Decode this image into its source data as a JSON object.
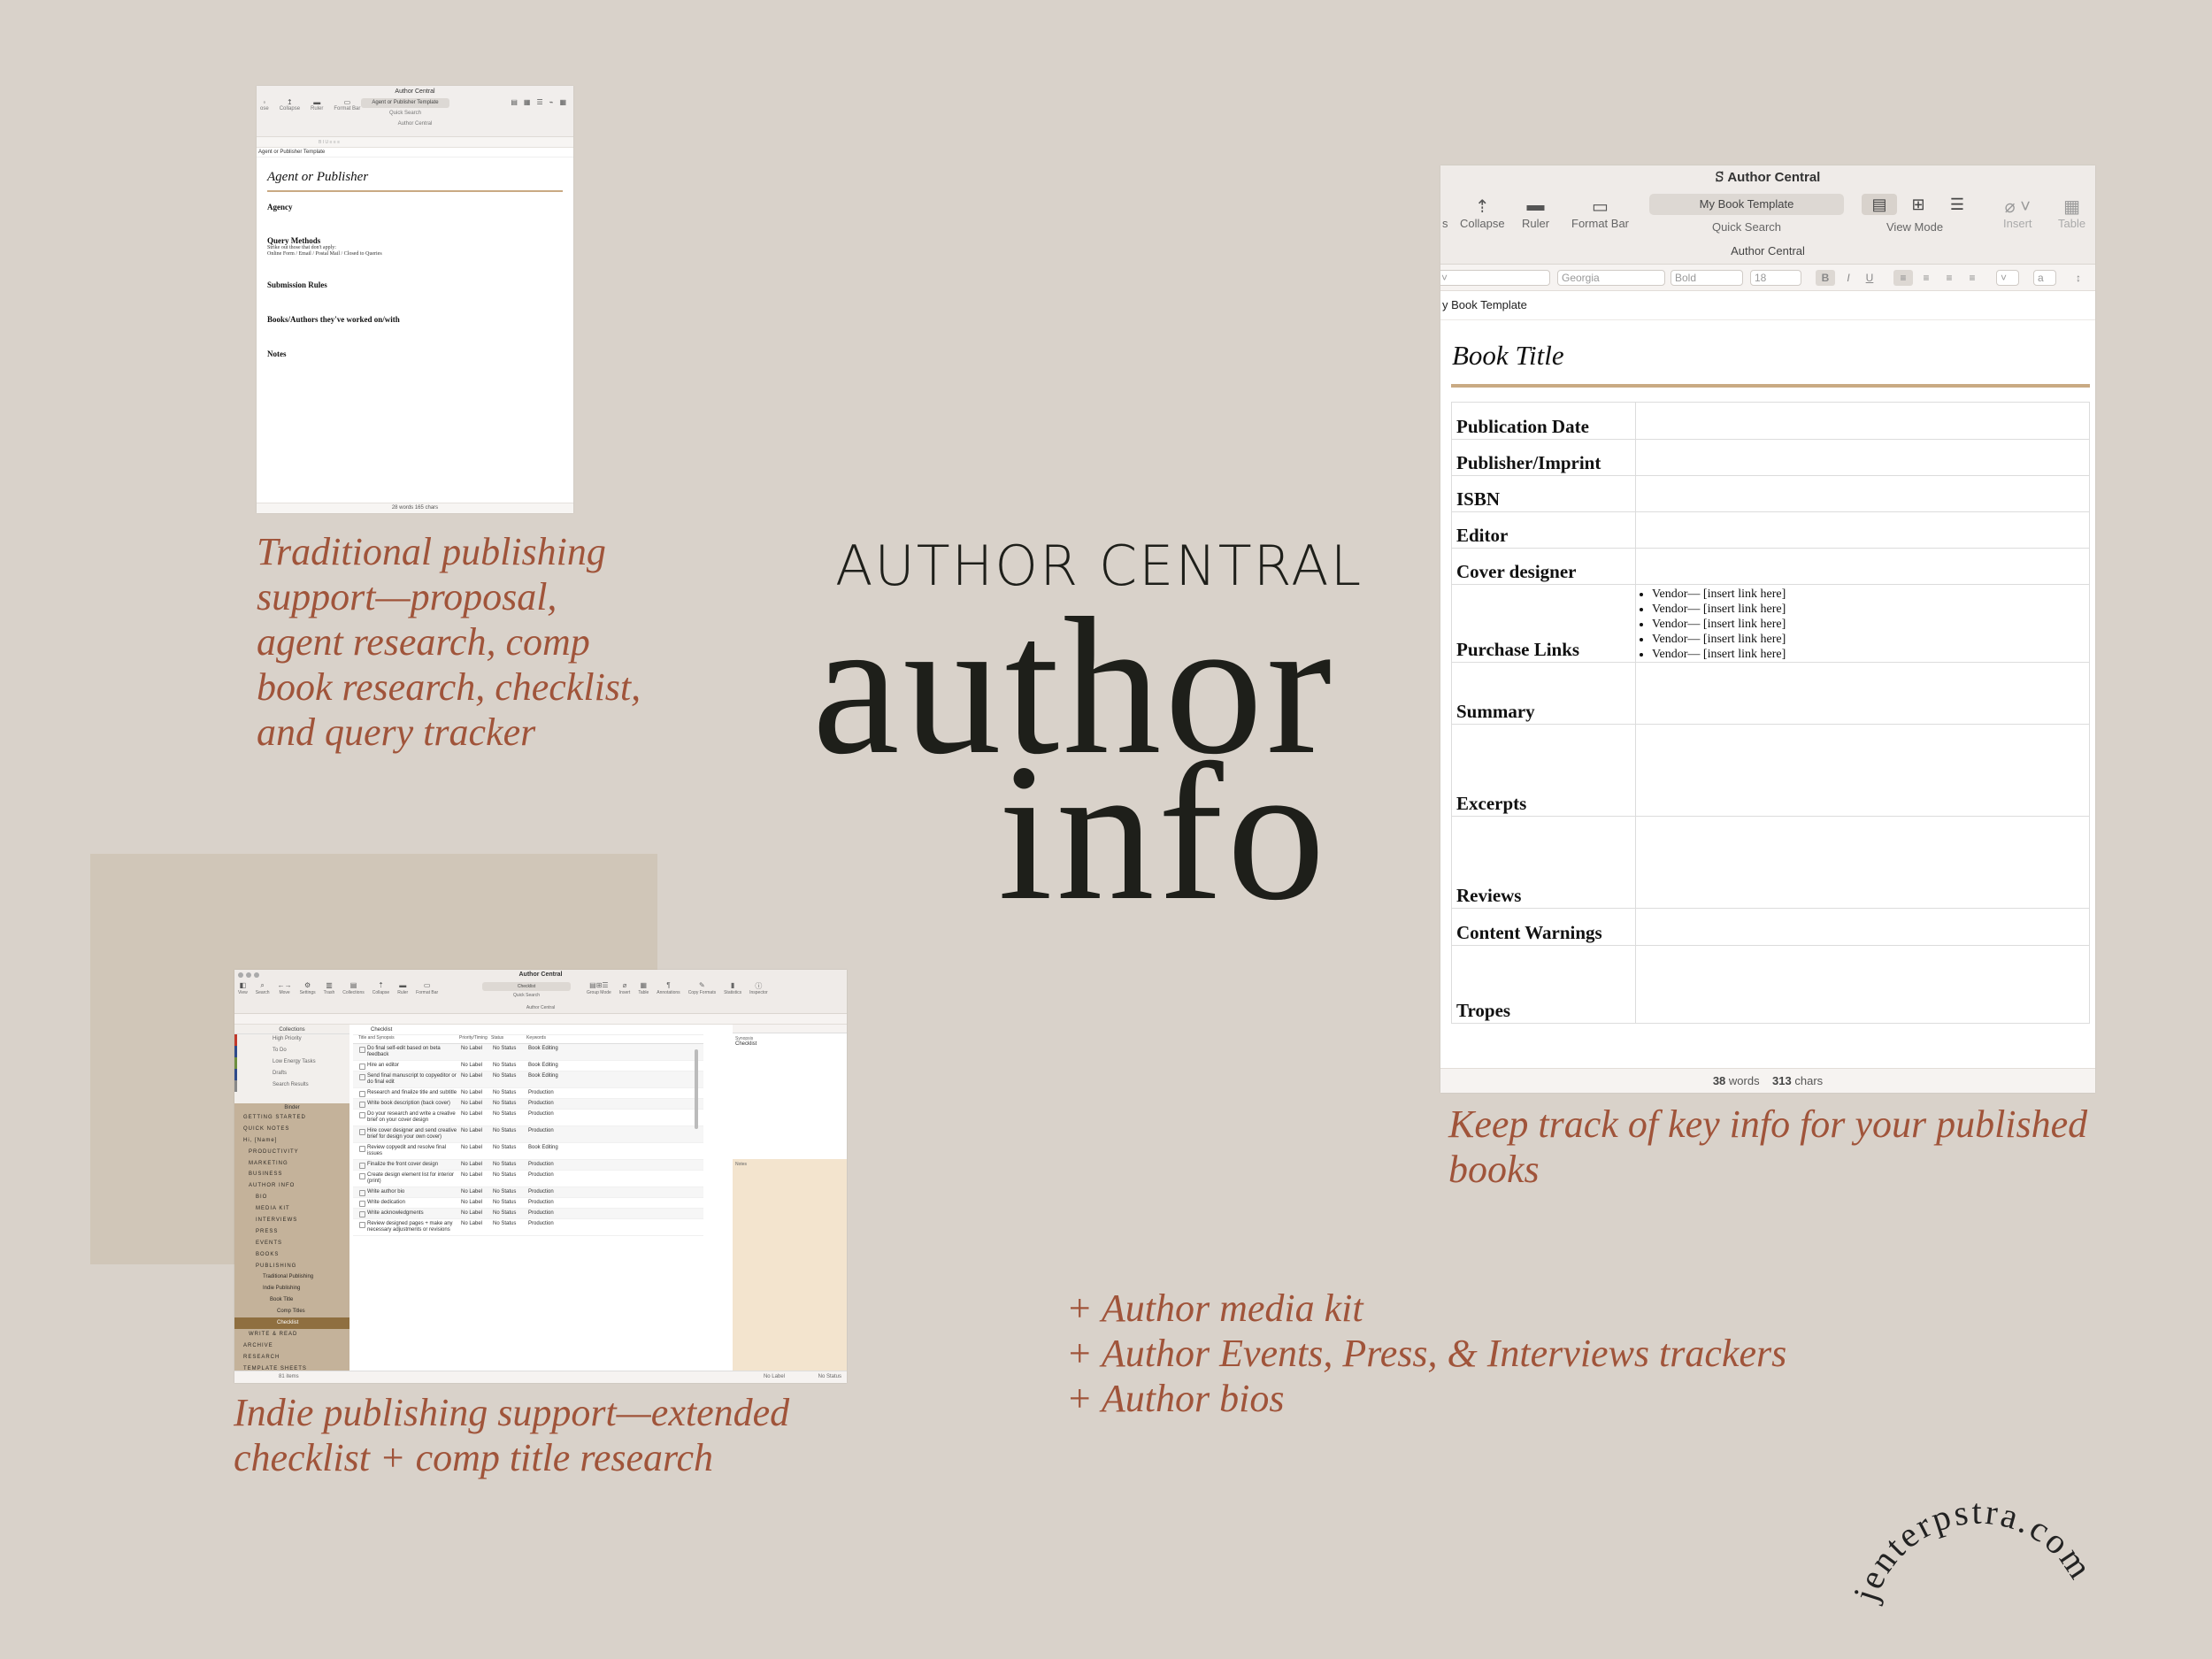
{
  "hero": {
    "title": "AUTHOR CENTRAL",
    "big_line1": "author",
    "big_line2": "info"
  },
  "captions": {
    "traditional": [
      "Traditional publishing",
      "support—proposal,",
      "agent research, comp",
      "book research, checklist,",
      "and query tracker"
    ],
    "published": [
      "Keep track of key info for your published",
      "books"
    ],
    "indie": [
      "Indie publishing support—extended",
      "checklist + comp title research"
    ],
    "extras": [
      "+ Author media kit",
      "+ Author Events, Press, & Interviews trackers",
      "+ Author bios"
    ]
  },
  "signature": "jenterpstra.com",
  "colors": {
    "background": "#d9d2ca",
    "caption": "#a0543a",
    "hero": "#1e1f1a",
    "accent_rule": "#c9aa83"
  },
  "window_agent": {
    "app_title": "Author Central",
    "toolbar": [
      {
        "label": "ose",
        "icon": "close-icon"
      },
      {
        "label": "Collapse",
        "icon": "collapse-icon"
      },
      {
        "label": "Ruler",
        "icon": "ruler-icon"
      },
      {
        "label": "Format Bar",
        "icon": "format-bar-icon"
      }
    ],
    "search_value": "Agent or Publisher Template",
    "search_label": "Quick Search",
    "view_label": "View Mode",
    "insert_label": "Insert",
    "table_label": "Table",
    "subtitle": "Author Central",
    "breadcrumb": "Agent or Publisher Template",
    "doc_title": "Agent or Publisher",
    "fields": [
      "Agency",
      "Query Methods",
      "Submission Rules",
      "Books/Authors they've worked on/with",
      "Notes"
    ],
    "query_note_1": "Strike out those that don't apply:",
    "query_note_2": "Online Form / Email / Postal Mail / Closed to Queries",
    "footer": "28 words   165 chars"
  },
  "window_book": {
    "app_title": "Author Central",
    "toolbar": [
      {
        "label": "s",
        "icon": "blank-icon"
      },
      {
        "label": "Collapse",
        "icon": "collapse-icon"
      },
      {
        "label": "Ruler",
        "icon": "ruler-icon"
      },
      {
        "label": "Format Bar",
        "icon": "format-bar-icon"
      }
    ],
    "search_value": "My Book Template",
    "search_label": "Quick Search",
    "view_label": "View Mode",
    "insert_label": "Insert",
    "table_label": "Table",
    "subtitle": "Author Central",
    "format": {
      "font": "Georgia",
      "weight": "Bold",
      "size": "18"
    },
    "breadcrumb": "y Book Template",
    "doc_title": "Book Title",
    "rows": [
      {
        "label": "Publication Date"
      },
      {
        "label": "Publisher/Imprint"
      },
      {
        "label": "ISBN"
      },
      {
        "label": "Editor"
      },
      {
        "label": "Cover designer"
      },
      {
        "label": "Purchase Links"
      },
      {
        "label": "Summary"
      },
      {
        "label": "Excerpts"
      },
      {
        "label": "Reviews"
      },
      {
        "label": "Content Warnings"
      },
      {
        "label": "Tropes"
      }
    ],
    "vendor_links": [
      "Vendor— [insert link here]",
      "Vendor— [insert link here]",
      "Vendor— [insert link here]",
      "Vendor— [insert link here]",
      "Vendor— [insert link here]"
    ],
    "footer_words": "38",
    "footer_words_label": "words",
    "footer_chars": "313",
    "footer_chars_label": "chars"
  },
  "window_checklist": {
    "app_title": "Author Central",
    "toolbar": [
      "View",
      "Search",
      "Move",
      "Settings",
      "Trash",
      "Collections",
      "Collapse",
      "Ruler",
      "Format Bar",
      "Group Mode",
      "Insert",
      "Table",
      "Annotations",
      "Copy Formats",
      "Statistics",
      "Inspector"
    ],
    "search_value": "Checklist",
    "search_label": "Quick Search",
    "subtitle": "Author Central",
    "collections_label": "Collections",
    "collections": [
      "High Priority",
      "To Do",
      "Low Energy Tasks",
      "Drafts",
      "Search Results"
    ],
    "binder_label": "Binder",
    "binder": [
      "GETTING STARTED",
      "QUICK NOTES",
      "Hi, [Name]",
      "PRODUCTIVITY",
      "MARKETING",
      "BUSINESS",
      "AUTHOR INFO",
      "BIO",
      "MEDIA KIT",
      "INTERVIEWS",
      "PRESS",
      "EVENTS",
      "BOOKS",
      "PUBLISHING",
      "Traditional Publishing",
      "Indie Publishing",
      "Book Title",
      "Comp Titles",
      "Checklist",
      "WRITE & READ",
      "ARCHIVE",
      "RESEARCH",
      "TEMPLATE SHEETS"
    ],
    "list_header": "Checklist",
    "columns": [
      "Title and Synopsis",
      "Priority/Timing",
      "Status",
      "Keywords"
    ],
    "tasks": [
      {
        "title": "Do final self-edit based on beta feedback",
        "label": "No Label",
        "status": "No Status",
        "keyword": "Book Editing"
      },
      {
        "title": "Hire an editor",
        "label": "No Label",
        "status": "No Status",
        "keyword": "Book Editing"
      },
      {
        "title": "Send final manuscript to copyeditor or do final edit",
        "label": "No Label",
        "status": "No Status",
        "keyword": "Book Editing"
      },
      {
        "title": "Research and finalize title and subtitle",
        "label": "No Label",
        "status": "No Status",
        "keyword": "Production"
      },
      {
        "title": "Write book description (back cover)",
        "label": "No Label",
        "status": "No Status",
        "keyword": "Production"
      },
      {
        "title": "Do your research and write a creative brief on your cover design",
        "label": "No Label",
        "status": "No Status",
        "keyword": "Production"
      },
      {
        "title": "Hire cover designer and send creative brief for design your own cover)",
        "label": "No Label",
        "status": "No Status",
        "keyword": "Production"
      },
      {
        "title": "Review copyedit and resolve final issues",
        "label": "No Label",
        "status": "No Status",
        "keyword": "Book Editing"
      },
      {
        "title": "Finalize the front cover design",
        "label": "No Label",
        "status": "No Status",
        "keyword": "Production"
      },
      {
        "title": "Create design element list for interior (print)",
        "label": "No Label",
        "status": "No Status",
        "keyword": "Production"
      },
      {
        "title": "Write author bio",
        "label": "No Label",
        "status": "No Status",
        "keyword": "Production"
      },
      {
        "title": "Write dedication",
        "label": "No Label",
        "status": "No Status",
        "keyword": "Production"
      },
      {
        "title": "Write acknowledgments",
        "label": "No Label",
        "status": "No Status",
        "keyword": "Production"
      },
      {
        "title": "Review designed pages + make any necessary adjustments or revisions",
        "label": "No Label",
        "status": "No Status",
        "keyword": "Production"
      }
    ],
    "inspector_title": "Checklist",
    "inspector_tab": "Synopsis",
    "notes_label": "Notes",
    "footer_items": "81 items",
    "footer_label": "No Label",
    "footer_status": "No Status"
  }
}
